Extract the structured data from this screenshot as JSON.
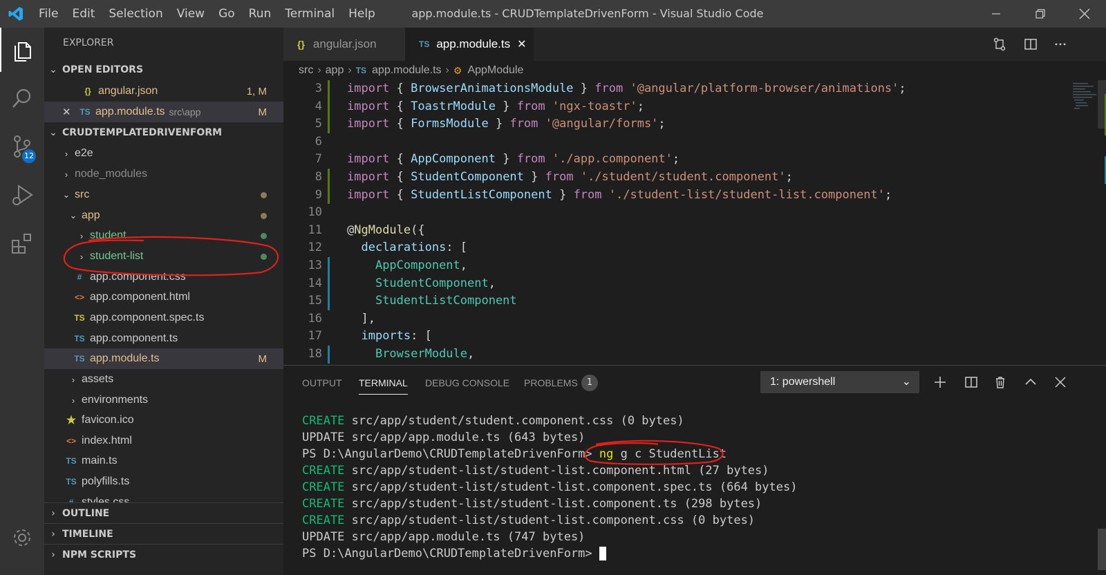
{
  "menu": [
    "File",
    "Edit",
    "Selection",
    "View",
    "Go",
    "Run",
    "Terminal",
    "Help"
  ],
  "window_title": "app.module.ts - CRUDTemplateDrivenForm - Visual Studio Code",
  "activity": {
    "scm_badge": "12"
  },
  "explorer": {
    "title": "EXPLORER",
    "open_editors_label": "OPEN EDITORS",
    "open_editors": [
      {
        "name": "angular.json",
        "icon": "{}",
        "status": "1, M"
      },
      {
        "name": "app.module.ts",
        "icon": "TS",
        "desc": "src\\app",
        "status": "M"
      }
    ],
    "project_label": "CRUDTEMPLATEDRIVENFORM",
    "tree": [
      {
        "name": "e2e"
      },
      {
        "name": "node_modules"
      },
      {
        "name": "src"
      },
      {
        "name": "app"
      },
      {
        "name": "student"
      },
      {
        "name": "student-list"
      },
      {
        "name": "app.component.css",
        "icon": "#"
      },
      {
        "name": "app.component.html",
        "icon": "<>"
      },
      {
        "name": "app.component.spec.ts",
        "icon": "TS"
      },
      {
        "name": "app.component.ts",
        "icon": "TS"
      },
      {
        "name": "app.module.ts",
        "icon": "TS",
        "status": "M"
      },
      {
        "name": "assets"
      },
      {
        "name": "environments"
      },
      {
        "name": "favicon.ico",
        "icon": "★"
      },
      {
        "name": "index.html",
        "icon": "<>"
      },
      {
        "name": "main.ts",
        "icon": "TS"
      },
      {
        "name": "polyfills.ts",
        "icon": "TS"
      },
      {
        "name": "styles.css",
        "icon": "#"
      }
    ],
    "outline_label": "OUTLINE",
    "timeline_label": "TIMELINE",
    "npm_label": "NPM SCRIPTS"
  },
  "tabs": [
    {
      "name": "angular.json",
      "icon": "{}"
    },
    {
      "name": "app.module.ts",
      "icon": "TS",
      "close": "✕"
    }
  ],
  "breadcrumb": {
    "src": "src",
    "app": "app",
    "file": "app.module.ts",
    "file_icon": "TS",
    "symbol": "AppModule"
  },
  "code_lines": [
    {
      "n": "3",
      "tokens": [
        [
          "kw",
          "import"
        ],
        [
          "pn",
          " { "
        ],
        [
          "id",
          "BrowserAnimationsModule"
        ],
        [
          "pn",
          " } "
        ],
        [
          "kw",
          "from"
        ],
        [
          "pn",
          " "
        ],
        [
          "str",
          "'@angular/platform-browser/animations'"
        ],
        [
          "pn",
          ";"
        ]
      ]
    },
    {
      "n": "4",
      "tokens": [
        [
          "kw",
          "import"
        ],
        [
          "pn",
          " { "
        ],
        [
          "id",
          "ToastrModule"
        ],
        [
          "pn",
          " } "
        ],
        [
          "kw",
          "from"
        ],
        [
          "pn",
          " "
        ],
        [
          "str",
          "'ngx-toastr'"
        ],
        [
          "pn",
          ";"
        ]
      ]
    },
    {
      "n": "5",
      "tokens": [
        [
          "kw",
          "import"
        ],
        [
          "pn",
          " { "
        ],
        [
          "id",
          "FormsModule"
        ],
        [
          "pn",
          " } "
        ],
        [
          "kw",
          "from"
        ],
        [
          "pn",
          " "
        ],
        [
          "str",
          "'@angular/forms'"
        ],
        [
          "pn",
          ";"
        ]
      ]
    },
    {
      "n": "6",
      "tokens": []
    },
    {
      "n": "7",
      "tokens": [
        [
          "kw",
          "import"
        ],
        [
          "pn",
          " { "
        ],
        [
          "id",
          "AppComponent"
        ],
        [
          "pn",
          " } "
        ],
        [
          "kw",
          "from"
        ],
        [
          "pn",
          " "
        ],
        [
          "str",
          "'./app.component'"
        ],
        [
          "pn",
          ";"
        ]
      ]
    },
    {
      "n": "8",
      "tokens": [
        [
          "kw",
          "import"
        ],
        [
          "pn",
          " { "
        ],
        [
          "id",
          "StudentComponent"
        ],
        [
          "pn",
          " } "
        ],
        [
          "kw",
          "from"
        ],
        [
          "pn",
          " "
        ],
        [
          "str",
          "'./student/student.component'"
        ],
        [
          "pn",
          ";"
        ]
      ]
    },
    {
      "n": "9",
      "tokens": [
        [
          "kw",
          "import"
        ],
        [
          "pn",
          " { "
        ],
        [
          "id",
          "StudentListComponent"
        ],
        [
          "pn",
          " } "
        ],
        [
          "kw",
          "from"
        ],
        [
          "pn",
          " "
        ],
        [
          "str",
          "'./student-list/student-list.component'"
        ],
        [
          "pn",
          ";"
        ]
      ]
    },
    {
      "n": "10",
      "tokens": []
    },
    {
      "n": "11",
      "tokens": [
        [
          "pn",
          "@"
        ],
        [
          "dec",
          "NgModule"
        ],
        [
          "pn",
          "({"
        ]
      ]
    },
    {
      "n": "12",
      "tokens": [
        [
          "pn",
          "  "
        ],
        [
          "id",
          "declarations"
        ],
        [
          "pn",
          ": ["
        ]
      ]
    },
    {
      "n": "13",
      "tokens": [
        [
          "pn",
          "    "
        ],
        [
          "cls",
          "AppComponent"
        ],
        [
          "pn",
          ","
        ]
      ]
    },
    {
      "n": "14",
      "tokens": [
        [
          "pn",
          "    "
        ],
        [
          "cls",
          "StudentComponent"
        ],
        [
          "pn",
          ","
        ]
      ]
    },
    {
      "n": "15",
      "tokens": [
        [
          "pn",
          "    "
        ],
        [
          "cls",
          "StudentListComponent"
        ]
      ]
    },
    {
      "n": "16",
      "tokens": [
        [
          "pn",
          "  ],"
        ]
      ]
    },
    {
      "n": "17",
      "tokens": [
        [
          "pn",
          "  "
        ],
        [
          "id",
          "imports"
        ],
        [
          "pn",
          ": ["
        ]
      ]
    },
    {
      "n": "18",
      "tokens": [
        [
          "pn",
          "    "
        ],
        [
          "cls",
          "BrowserModule"
        ],
        [
          "pn",
          ","
        ]
      ]
    }
  ],
  "panel": {
    "tabs": [
      "OUTPUT",
      "TERMINAL",
      "DEBUG CONSOLE",
      "PROBLEMS"
    ],
    "problems_count": "1",
    "terminal_select": "1: powershell",
    "lines": [
      {
        "kind": "CREATE",
        "rest": " src/app/student/student.component.css (0 bytes)"
      },
      {
        "kind": "UPDATE",
        "rest": " src/app/app.module.ts (643 bytes)"
      },
      {
        "kind": "PS",
        "rest": "PS D:\\AngularDemo\\CRUDTemplateDrivenForm> ",
        "cmd": "ng g c StudentList"
      },
      {
        "kind": "CREATE",
        "rest": " src/app/student-list/student-list.component.html (27 bytes)"
      },
      {
        "kind": "CREATE",
        "rest": " src/app/student-list/student-list.component.spec.ts (664 bytes)"
      },
      {
        "kind": "CREATE",
        "rest": " src/app/student-list/student-list.component.ts (298 bytes)"
      },
      {
        "kind": "CREATE",
        "rest": " src/app/student-list/student-list.component.css (0 bytes)"
      },
      {
        "kind": "UPDATE",
        "rest": " src/app/app.module.ts (747 bytes)"
      },
      {
        "kind": "PROMPT",
        "rest": "PS D:\\AngularDemo\\CRUDTemplateDrivenForm> "
      }
    ]
  },
  "colors": {
    "accent": "#0e70c0",
    "git_modified": "#e2c08d",
    "git_added": "#73c991",
    "annotation": "#e0201a"
  }
}
